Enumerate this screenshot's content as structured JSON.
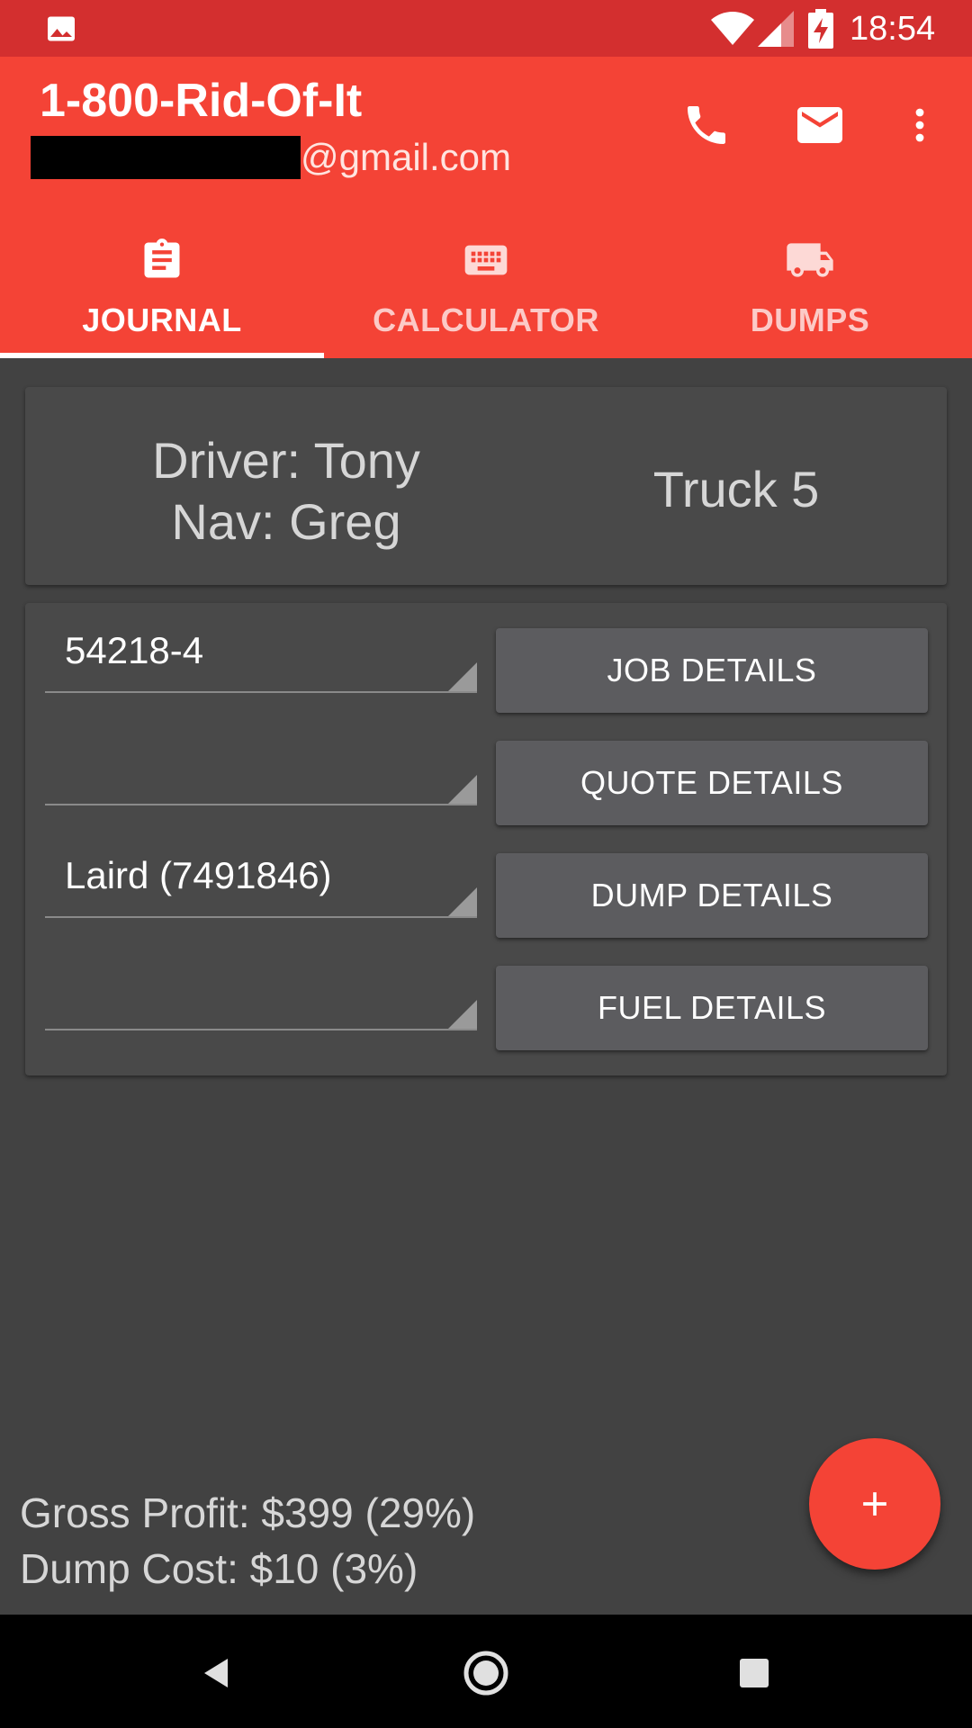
{
  "status_bar": {
    "time": "18:54",
    "icons": [
      "gallery-icon",
      "wifi-icon",
      "signal-icon",
      "battery-charging-icon"
    ]
  },
  "app_bar": {
    "title": "1-800-Rid-Of-It",
    "email_visible": "@gmail.com",
    "actions": [
      "phone-icon",
      "mail-icon",
      "more-vert-icon"
    ]
  },
  "tabs": [
    {
      "label": "JOURNAL",
      "icon": "clipboard-icon",
      "active": true
    },
    {
      "label": "CALCULATOR",
      "icon": "keyboard-icon",
      "active": false
    },
    {
      "label": "DUMPS",
      "icon": "truck-icon",
      "active": false
    }
  ],
  "crew": {
    "driver": "Driver: Tony",
    "nav": "Nav: Greg",
    "truck": "Truck 5"
  },
  "job": {
    "spinners": [
      "54218-4",
      "",
      "Laird (7491846)",
      ""
    ],
    "buttons": [
      "JOB DETAILS",
      "QUOTE DETAILS",
      "DUMP DETAILS",
      "FUEL DETAILS"
    ]
  },
  "summary": {
    "gross_profit": "Gross Profit: $399 (29%)",
    "dump_cost": "Dump Cost: $10 (3%)"
  },
  "fab": {
    "icon": "plus-icon"
  },
  "nav_bar": {
    "buttons": [
      "back-icon",
      "home-icon",
      "recents-icon"
    ]
  },
  "colors": {
    "primary": "#f44336",
    "primary_dark": "#d32f2f",
    "background": "#424242",
    "card": "#494949",
    "button": "#5c5c5f"
  }
}
